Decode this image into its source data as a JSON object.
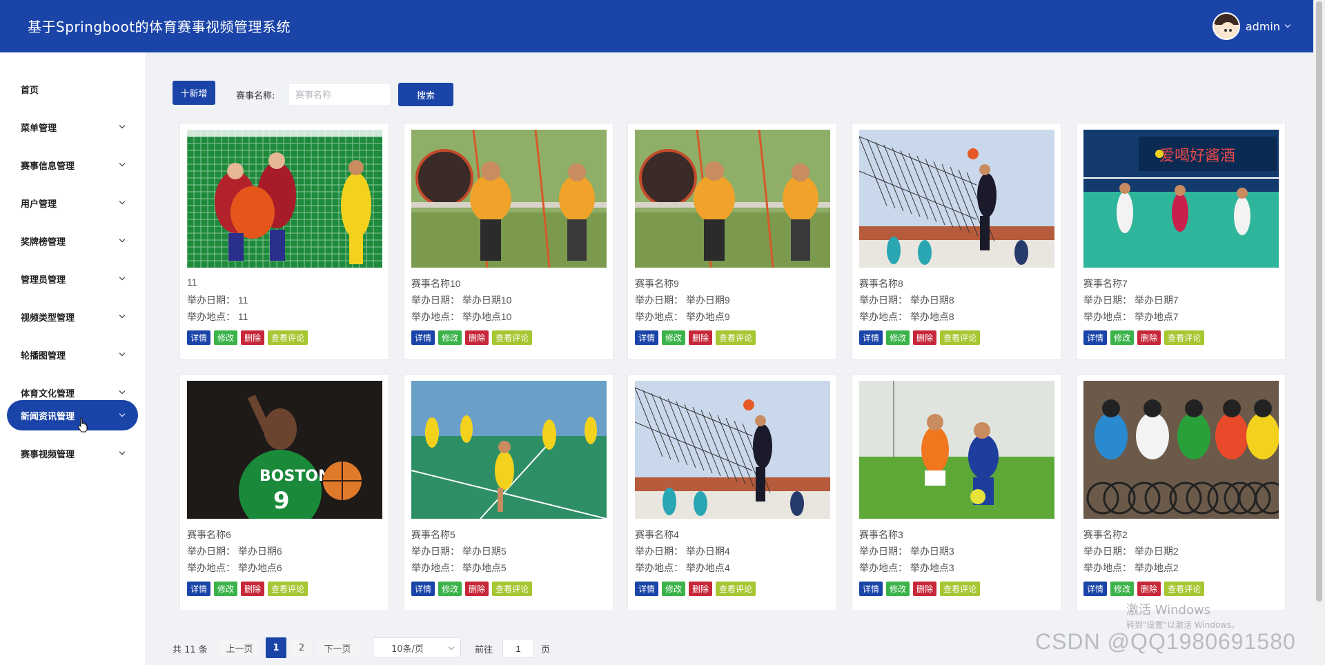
{
  "header": {
    "title": "基于Springboot的体育赛事视频管理系统",
    "username": "admin"
  },
  "sidebar": {
    "items": [
      {
        "label": "首页",
        "has_arrow": false,
        "active": false
      },
      {
        "label": "菜单管理",
        "has_arrow": true,
        "active": false
      },
      {
        "label": "赛事信息管理",
        "has_arrow": true,
        "active": false
      },
      {
        "label": "用户管理",
        "has_arrow": true,
        "active": false
      },
      {
        "label": "奖牌榜管理",
        "has_arrow": true,
        "active": false
      },
      {
        "label": "管理员管理",
        "has_arrow": true,
        "active": false
      },
      {
        "label": "视频类型管理",
        "has_arrow": true,
        "active": false
      },
      {
        "label": "轮播图管理",
        "has_arrow": true,
        "active": false
      },
      {
        "label": "体育文化管理",
        "has_arrow": true,
        "active": false
      },
      {
        "label": "新闻资讯管理",
        "has_arrow": true,
        "active": true
      },
      {
        "label": "赛事视频管理",
        "has_arrow": true,
        "active": false
      }
    ]
  },
  "toolbar": {
    "add_label": "十新增",
    "search_label": "赛事名称:",
    "search_placeholder": "赛事名称",
    "search_button": "搜索"
  },
  "cards": [
    {
      "name": "11",
      "date": "举办日期：  11",
      "place": "举办地点：  11",
      "image": "futsal-goalkeeper-photo"
    },
    {
      "name": "赛事名称10",
      "date": "举办日期：  举办日期10",
      "place": "举办地点：  举办地点10",
      "image": "tug-of-war-kids-photo"
    },
    {
      "name": "赛事名称9",
      "date": "举办日期：  举办日期9",
      "place": "举办地点：  举办地点9",
      "image": "tug-of-war-kids-photo"
    },
    {
      "name": "赛事名称8",
      "date": "举办日期：  举办日期8",
      "place": "举办地点：  举办地点8",
      "image": "volleyball-spike-photo"
    },
    {
      "name": "赛事名称7",
      "date": "举办日期：  举办日期7",
      "place": "举办地点：  举办地点7",
      "image": "indoor-volleyball-photo"
    },
    {
      "name": "赛事名称6",
      "date": "举办日期：  举办日期6",
      "place": "举办地点：  举办地点6",
      "image": "basketball-player-photo"
    },
    {
      "name": "赛事名称5",
      "date": "举办日期：  举办日期5",
      "place": "举办地点：  举办地点5",
      "image": "badminton-court-photo"
    },
    {
      "name": "赛事名称4",
      "date": "举办日期：  举办日期4",
      "place": "举办地点：  举办地点4",
      "image": "volleyball-spike-photo"
    },
    {
      "name": "赛事名称3",
      "date": "举办日期：  举办日期3",
      "place": "举办地点：  举办地点3",
      "image": "kids-football-photo"
    },
    {
      "name": "赛事名称2",
      "date": "举办日期：  举办日期2",
      "place": "举办地点：  举办地点2",
      "image": "cycling-race-photo"
    }
  ],
  "card_actions": {
    "detail": "详情",
    "edit": "修改",
    "delete": "删除",
    "comments": "查看评论"
  },
  "pagination": {
    "total": "共 11 条",
    "prev": "上一页",
    "pages": [
      "1",
      "2"
    ],
    "current": "1",
    "next": "下一页",
    "page_size": "10条/页",
    "goto_label": "前往",
    "goto_value": "1",
    "page_suffix": "页"
  },
  "watermarks": {
    "windows_line1": "激活 Windows",
    "windows_line2": "转到\"设置\"以激活 Windows。",
    "csdn": "CSDN @QQ1980691580"
  },
  "colors": {
    "primary": "#1a44a8",
    "edit": "#3bb34a",
    "delete": "#c6283a",
    "comments": "#a6c632"
  }
}
